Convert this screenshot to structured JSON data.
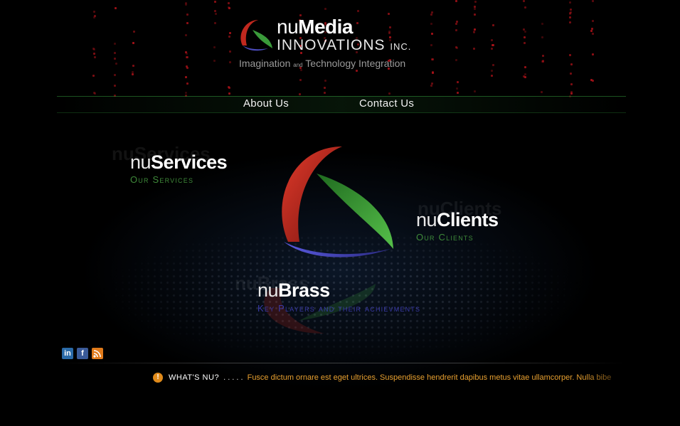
{
  "header": {
    "brand_nu": "nu",
    "brand_media": "Media",
    "brand_innovations": "INNOVATIONS",
    "brand_inc": "INC.",
    "tagline_left": "Imagination",
    "tagline_and": "and",
    "tagline_right": "Technology Integration"
  },
  "nav": {
    "about": "About Us",
    "contact": "Contact Us"
  },
  "sections": {
    "services": {
      "prefix": "nu",
      "word": "Services",
      "subtitle": "Our Services",
      "ghost": "nuServices"
    },
    "clients": {
      "prefix": "nu",
      "word": "Clients",
      "subtitle": "Our Clients",
      "ghost": "nuClients"
    },
    "brass": {
      "prefix": "nu",
      "word": "Brass",
      "subtitle": "Key Players and their achievments",
      "ghost": "nuBrass"
    }
  },
  "social": {
    "linkedin_label": "in",
    "facebook_label": "f",
    "rss_label": "rss-icon"
  },
  "ticker": {
    "icon": "!",
    "label": "WHAT'S NU?",
    "dots": ". . . . .",
    "text": "Fusce dictum ornare est eget ultrices. Suspendisse hendrerit dapibus metus vitae ullamcorper. Nulla bibe"
  },
  "colors": {
    "red": "#c0281e",
    "green": "#3a9a3a",
    "blue": "#4a4ab8",
    "subtitle_green": "#3f8a3a",
    "subtitle_blue": "#3a3aa8",
    "ticker_text": "#e8a030"
  }
}
